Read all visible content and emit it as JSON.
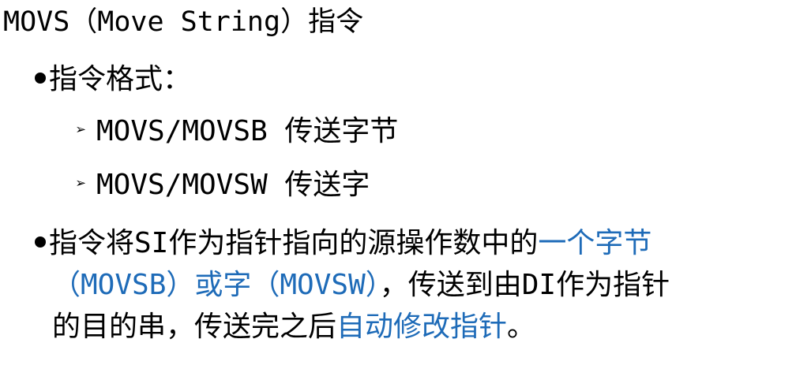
{
  "title": "MOVS（Move String）指令",
  "section_format": {
    "bullet_text": "指令格式："
  },
  "sub_items": [
    {
      "arrow": "➢",
      "text": "MOVS/MOVSB 传送字节"
    },
    {
      "arrow": "➢",
      "text": "MOVS/MOVSW 传送字"
    }
  ],
  "description": {
    "line1_prefix": "指令将SI作为指针指向的源操作数中的",
    "line1_highlight": "一个字节",
    "line2_highlight": "（MOVSB）或字（MOVSW）",
    "line2_suffix": "，传送到由DI作为指针",
    "line3_prefix": "的目的串，传送完之后",
    "line3_highlight": "自动修改指针",
    "line3_suffix": "。"
  },
  "colors": {
    "text": "#000000",
    "highlight": "#1e6bb8",
    "background": "#ffffff"
  }
}
